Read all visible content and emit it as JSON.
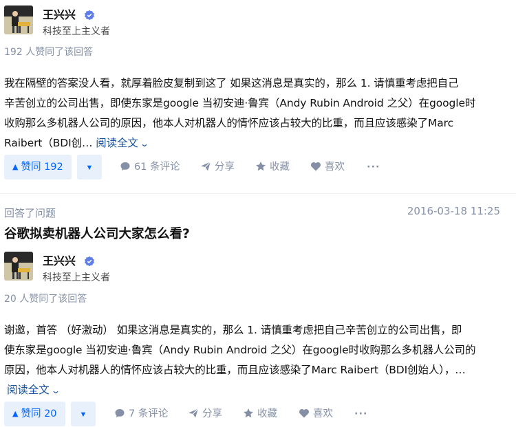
{
  "answers": [
    {
      "author": {
        "name": "王兴兴",
        "headline": "科技至上主义者",
        "verified_icon": "verified-badge-icon"
      },
      "upvote_meta": "192 人赞同了该回答",
      "excerpt_lines": [
        "我在隔壁的答案没人看，就厚着脸皮复制到这了 如果这消息是真实的，那么 1. 请慎重考虑把自己",
        "辛苦创立的公司出售，即使东家是google 当初安迪·鲁宾（Andy Rubin Android 之父）在google时",
        "收购那么多机器人公司的原因，他本人对机器人的情怀应该占较大的比重，而且应该感染了Marc",
        "Raibert（BDI创… "
      ],
      "read_more": "阅读全文",
      "actions": {
        "upvote": "赞同 192",
        "comments": "61 条评论",
        "share": "分享",
        "favorite": "收藏",
        "like": "喜欢",
        "more": "···"
      }
    },
    {
      "activity_label": "回答了问题",
      "date": "2016-03-18 11:25",
      "question_title": "谷歌拟卖机器人公司大家怎么看?",
      "author": {
        "name": "王兴兴",
        "headline": "科技至上主义者",
        "verified_icon": "verified-badge-icon"
      },
      "upvote_meta": "20 人赞同了该回答",
      "excerpt_lines": [
        "谢邀，首答 （好激动） 如果这消息是真实的，那么 1. 请慎重考虑把自己辛苦创立的公司出售，即",
        "使东家是google 当初安迪·鲁宾（Andy Rubin Android 之父）在google时收购那么多机器人公司的",
        "原因，他本人对机器人的情怀应该占较大的比重，而且应该感染了Marc Raibert（BDI创始人），…"
      ],
      "read_more": "阅读全文",
      "actions": {
        "upvote": "赞同 20",
        "comments": "7 条评论",
        "share": "分享",
        "favorite": "收藏",
        "like": "喜欢",
        "more": "···"
      }
    }
  ],
  "colors": {
    "accent": "#0066ff",
    "accent_bg": "#e8f0fb",
    "meta": "#8590a6",
    "link": "#175199"
  }
}
